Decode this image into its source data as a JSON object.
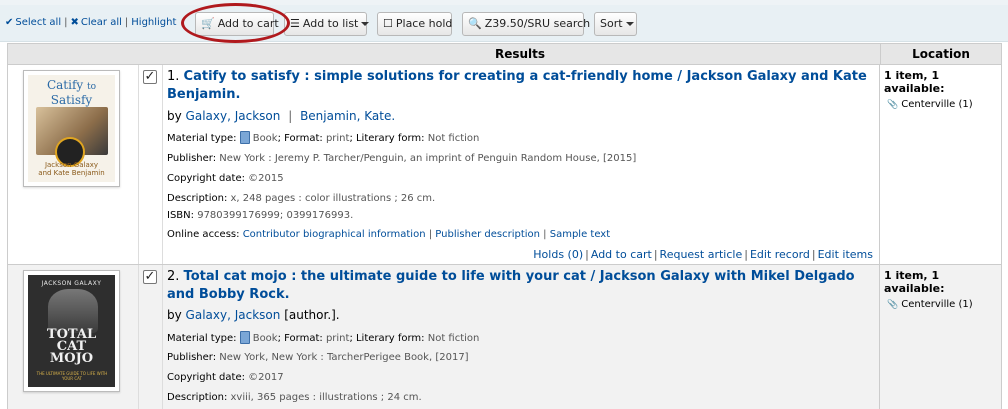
{
  "toolbar": {
    "select_all": "Select all",
    "clear_all": "Clear all",
    "highlight": "Highlight",
    "add_to_cart": "Add to cart",
    "add_to_list": "Add to list",
    "place_hold": "Place hold",
    "z3950": "Z39.50/SRU search",
    "sort": "Sort"
  },
  "table": {
    "header_results": "Results",
    "header_location": "Location"
  },
  "results": [
    {
      "number": "1.",
      "title": "Catify to satisfy : simple solutions for creating a cat-friendly home / Jackson Galaxy and Kate Benjamin.",
      "by": "by",
      "author1": "Galaxy, Jackson",
      "author_sep": "|",
      "author2": "Benjamin, Kate.",
      "material_label": "Material type:",
      "material_value": "Book",
      "format_label": "; Format:",
      "format_value": "print",
      "literary_label": "; Literary form:",
      "literary_value": "Not fiction",
      "publisher_label": "Publisher:",
      "publisher_value": "New York : Jeremy P. Tarcher/Penguin, an imprint of Penguin Random House, [2015]",
      "copyright_label": "Copyright date:",
      "copyright_value": "©2015",
      "description_label": "Description:",
      "description_value": "x, 248 pages : color illustrations ; 26 cm.",
      "isbn_label": "ISBN:",
      "isbn_value": "9780399176999; 0399176993.",
      "online_label": "Online access:",
      "online_links": [
        "Contributor biographical information",
        "Publisher description",
        "Sample text"
      ],
      "actions": [
        "Holds (0)",
        "Add to cart",
        "Request article",
        "Edit record",
        "Edit items"
      ],
      "location_avail": "1 item, 1 available:",
      "location_branch": "Centerville (1)",
      "cover": {
        "line1": "Catify",
        "line2": "to",
        "line3": "Satisfy",
        "author": "Jackson Galaxy",
        "author2": "and Kate Benjamin"
      }
    },
    {
      "number": "2.",
      "title": "Total cat mojo : the ultimate guide to life with your cat / Jackson Galaxy with Mikel Delgado and Bobby Rock.",
      "by": "by",
      "author1": "Galaxy, Jackson",
      "author_role": "[author.].",
      "material_label": "Material type:",
      "material_value": "Book",
      "format_label": "; Format:",
      "format_value": "print",
      "literary_label": "; Literary form:",
      "literary_value": "Not fiction",
      "publisher_label": "Publisher:",
      "publisher_value": "New York, New York : TarcherPerigee Book, [2017]",
      "copyright_label": "Copyright date:",
      "copyright_value": "©2017",
      "description_label": "Description:",
      "description_value": "xviii, 365 pages : illustrations ; 24 cm.",
      "location_avail": "1 item, 1 available:",
      "location_branch": "Centerville (1)",
      "cover": {
        "top": "JACKSON GALAXY",
        "line1": "TOTAL",
        "line2": "CAT",
        "line3": "MOJO",
        "sub": "THE ULTIMATE GUIDE TO LIFE WITH YOUR CAT"
      }
    }
  ],
  "colors": {
    "link": "#004d99",
    "ring": "#b0191d",
    "toolbar_bg": "#e8f0f4"
  }
}
